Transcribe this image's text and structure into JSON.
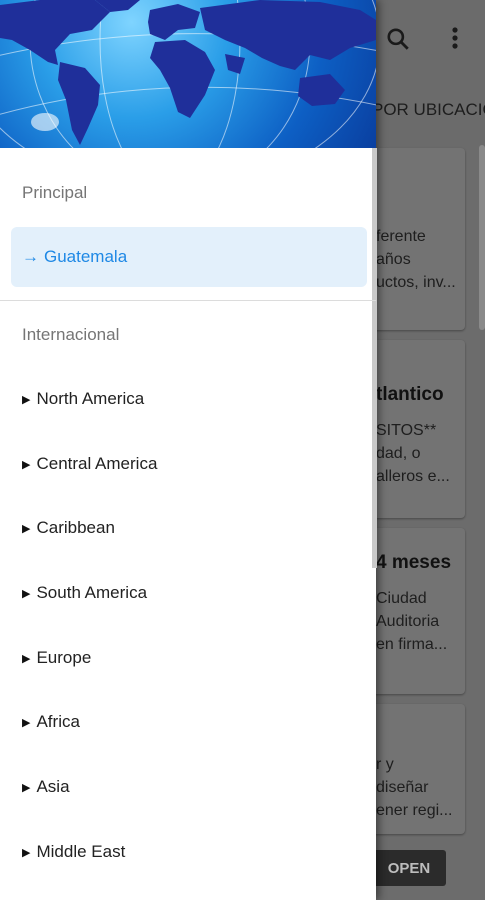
{
  "background": {
    "tab_label": "POR UBICACIO",
    "search_icon": "search-icon",
    "more_icon": "more-vert-icon",
    "cards": [
      {
        "title": "",
        "lines": [
          "ferente",
          "años",
          "uctos, inv..."
        ]
      },
      {
        "title": "tlantico",
        "lines": [
          "SITOS**",
          "dad, o",
          "alleros e..."
        ]
      },
      {
        "title": "4 meses",
        "lines": [
          "Ciudad",
          "Auditoria",
          "en firma..."
        ]
      },
      {
        "title": "",
        "lines": [
          "r y",
          "diseñar",
          "ener regi..."
        ]
      }
    ],
    "open_button": "OPEN"
  },
  "drawer": {
    "header_image": "world-map-globe",
    "principal_label": "Principal",
    "selected_item": {
      "arrow": "→",
      "label": "Guatemala"
    },
    "internacional_label": "Internacional",
    "items": [
      {
        "label": "North America"
      },
      {
        "label": "Central America"
      },
      {
        "label": "Caribbean"
      },
      {
        "label": "South America"
      },
      {
        "label": "Europe"
      },
      {
        "label": "Africa"
      },
      {
        "label": "Asia"
      },
      {
        "label": "Middle East"
      }
    ],
    "bullet": "▶"
  },
  "colors": {
    "selected_text": "#1e88e5",
    "selected_bg": "#e3f0fb",
    "header_blue": "#0d5fc4"
  }
}
